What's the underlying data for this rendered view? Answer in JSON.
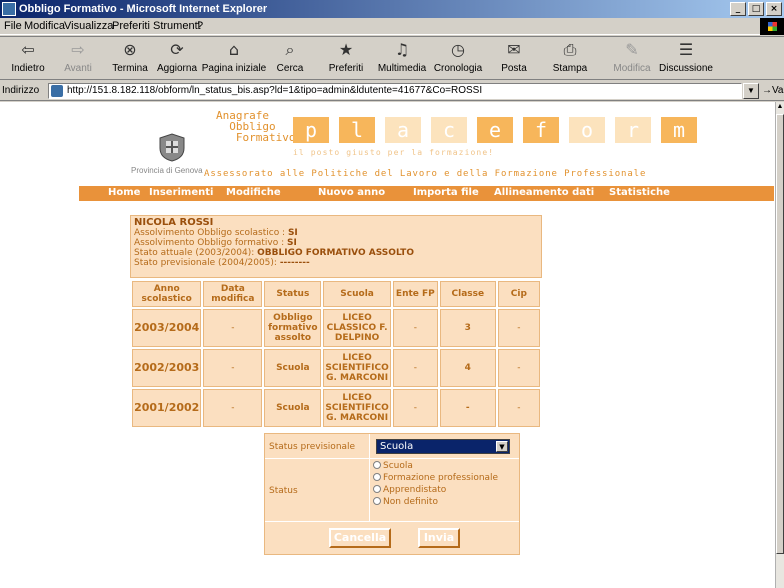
{
  "window": {
    "title": "Obbligo Formativo - Microsoft Internet Explorer"
  },
  "menu": [
    "File",
    "Modifica",
    "Visualizza",
    "Preferiti",
    "Strumenti",
    "?"
  ],
  "toolbar": [
    {
      "label": "Indietro",
      "icon": "back-arrow-icon",
      "glyph": "⇦"
    },
    {
      "label": "Avanti",
      "icon": "forward-arrow-icon",
      "glyph": "⇨"
    },
    {
      "label": "Termina",
      "icon": "stop-icon",
      "glyph": "⊗"
    },
    {
      "label": "Aggiorna",
      "icon": "refresh-icon",
      "glyph": "⟳"
    },
    {
      "label": "Pagina iniziale",
      "icon": "home-icon",
      "glyph": "⌂"
    },
    {
      "label": "Cerca",
      "icon": "search-icon",
      "glyph": "⌕"
    },
    {
      "label": "Preferiti",
      "icon": "favorites-icon",
      "glyph": "★"
    },
    {
      "label": "Multimedia",
      "icon": "media-icon",
      "glyph": "♫"
    },
    {
      "label": "Cronologia",
      "icon": "history-icon",
      "glyph": "◷"
    },
    {
      "label": "Posta",
      "icon": "mail-icon",
      "glyph": "✉"
    },
    {
      "label": "Stampa",
      "icon": "print-icon",
      "glyph": "⎙"
    },
    {
      "label": "Modifica",
      "icon": "edit-icon",
      "glyph": "✎"
    },
    {
      "label": "Discussione",
      "icon": "discuss-icon",
      "glyph": "☰"
    }
  ],
  "address": {
    "label": "Indirizzo",
    "url": "http://151.8.182.118/obform/ln_status_bis.asp?ld=1&tipo=admin&ldutente=41677&Co=ROSSI",
    "go": "Vai"
  },
  "header": {
    "anagrafe": [
      "Anagrafe",
      "  Obbligo",
      "   Formativo"
    ],
    "letters": [
      "p",
      "l",
      "a",
      "c",
      "e",
      "f",
      "o",
      "r",
      "m"
    ],
    "slogan": "il posto giusto per la formazione!",
    "province": "Provincia di Genova",
    "assessorato": "Assessorato alle Politiche del Lavoro e della Formazione Professionale"
  },
  "nav": [
    "Home",
    "Inserimenti",
    "Modifiche",
    "Nuovo anno",
    "Importa file",
    "Allineamento dati",
    "Statistiche"
  ],
  "student": {
    "name": "NICOLA ROSSI",
    "line1_label": "Assolvimento Obbligo scolastico : ",
    "line1_value": "SI",
    "line2_label": "Assolvimento Obbligo formativo : ",
    "line2_value": "SI",
    "line3_label": "Stato attuale (2003/2004): ",
    "line3_value": "OBBLIGO FORMATIVO ASSOLTO",
    "line4_label": "Stato previsionale (2004/2005): ",
    "line4_value": "--------"
  },
  "table": {
    "headers": [
      "Anno scolastico",
      "Data modifica",
      "Status",
      "Scuola",
      "Ente FP",
      "Classe",
      "Cip"
    ],
    "rows": [
      [
        "2003/2004",
        "-",
        "Obbligo formativo assolto",
        "LICEO CLASSICO F. DELPINO",
        "-",
        "3",
        "-"
      ],
      [
        "2002/2003",
        "-",
        "Scuola",
        "LICEO SCIENTIFICO G. MARCONI",
        "-",
        "4",
        "-"
      ],
      [
        "2001/2002",
        "-",
        "Scuola",
        "LICEO SCIENTIFICO G. MARCONI",
        "-",
        "-",
        "-"
      ]
    ]
  },
  "form": {
    "status_prev_label": "Status previsionale",
    "status_prev_value": "Scuola",
    "status_label": "Status",
    "options": [
      "Scuola",
      "Formazione professionale",
      "Apprendistato",
      "Non definito"
    ],
    "cancel": "Cancella",
    "submit": "Invia"
  },
  "colors": {
    "accent": "#e9923a",
    "panel": "#fbdfc0",
    "text": "#b56b1a"
  }
}
